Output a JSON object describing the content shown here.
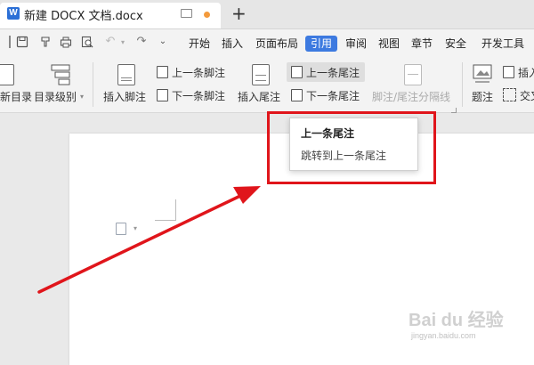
{
  "titlebar": {
    "app_badge": "W",
    "doc_title": "新建 DOCX 文档.docx",
    "new_tab": "+"
  },
  "menu": {
    "items": [
      "开始",
      "插入",
      "页面布局",
      "引用",
      "审阅",
      "视图",
      "章节",
      "安全",
      "开发工具"
    ],
    "active": "引用"
  },
  "ribbon": {
    "toc_update": "新目录",
    "toc_level": "目录级别",
    "insert_footnote": "插入脚注",
    "prev_footnote": "上一条脚注",
    "next_footnote": "下一条脚注",
    "insert_endnote": "插入尾注",
    "prev_endnote": "上一条尾注",
    "next_endnote": "下一条尾注",
    "separator_line": "脚注/尾注分隔线",
    "caption": "题注",
    "insert_partial": "插入",
    "cross_ref": "交叉"
  },
  "tooltip": {
    "title": "上一条尾注",
    "description": "跳转到上一条尾注"
  },
  "watermark": {
    "brand": "Bai du 经验",
    "url": "jingyan.baidu.com"
  },
  "colors": {
    "accent": "#3d7ae0",
    "annotation_red": "#e0151b",
    "unsaved_dot": "#f39a3c"
  }
}
